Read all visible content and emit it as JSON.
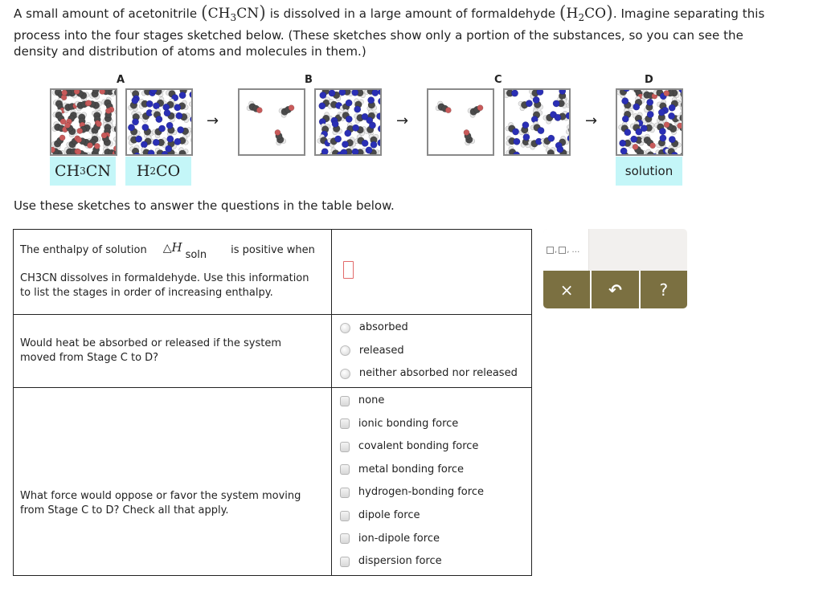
{
  "intro": {
    "line1_a": "A small amount of acetonitrile",
    "solute_formula": {
      "main": "CH",
      "sub": "3",
      "tail": "CN"
    },
    "line1_b": "is dissolved in a large amount of formaldehyde",
    "solvent_formula": {
      "main": "H",
      "sub": "2",
      "tail": "CO"
    },
    "line1_c": ". Imagine separating this",
    "line2": "process into the four stages sketched below. (These sketches show only a portion of the substances, so you can see the",
    "line3": "density and distribution of atoms and molecules in them.)"
  },
  "stages": [
    {
      "letter": "A",
      "labels": [
        {
          "main": "CH",
          "sub": "3",
          "tail": "CN"
        },
        {
          "main": "H",
          "sub": "2",
          "tail": "CO"
        }
      ]
    },
    {
      "letter": "B"
    },
    {
      "letter": "C"
    },
    {
      "letter": "D",
      "label": "solution"
    }
  ],
  "arrow": "→",
  "molecule_colors": {
    "carbon": "#4a4a4a",
    "hydrogen": "#e8e8e8",
    "oxygen": "#c85a5a",
    "nitrogen": "#2a2fb5"
  },
  "instructions": "Use these sketches to answer the questions in the table below.",
  "questions": [
    {
      "text_a": "The enthalpy of solution",
      "symbol_delta": "△",
      "symbol_h": "H",
      "symbol_sub": "soln",
      "text_b": "is positive when",
      "text_c": "CH3CN dissolves in formaldehyde. Use this information",
      "text_d": "to list the stages in order of increasing enthalpy.",
      "answer_value": ""
    },
    {
      "text_a": "Would heat be absorbed or released if the system",
      "text_b": "moved from Stage C to D?",
      "options": [
        "absorbed",
        "released",
        "neither absorbed nor released"
      ]
    },
    {
      "text_a": "What force would oppose or favor the system moving",
      "text_b": "from Stage C to D? Check all that apply.",
      "options": [
        "none",
        "ionic bonding force",
        "covalent bonding force",
        "metal bonding force",
        "hydrogen-bonding force",
        "dipole force",
        "ion-dipole force",
        "dispersion force"
      ]
    }
  ],
  "tools": {
    "list_template_icon": "list-template-icon",
    "list_template_ellipsis": "…",
    "clear_label": "×",
    "undo_label": "↶",
    "help_label": "?"
  },
  "colors": {
    "label_bg": "#c4f6f8",
    "tool_button": "#7b7041",
    "answer_slot_border": "#e26a6a"
  }
}
